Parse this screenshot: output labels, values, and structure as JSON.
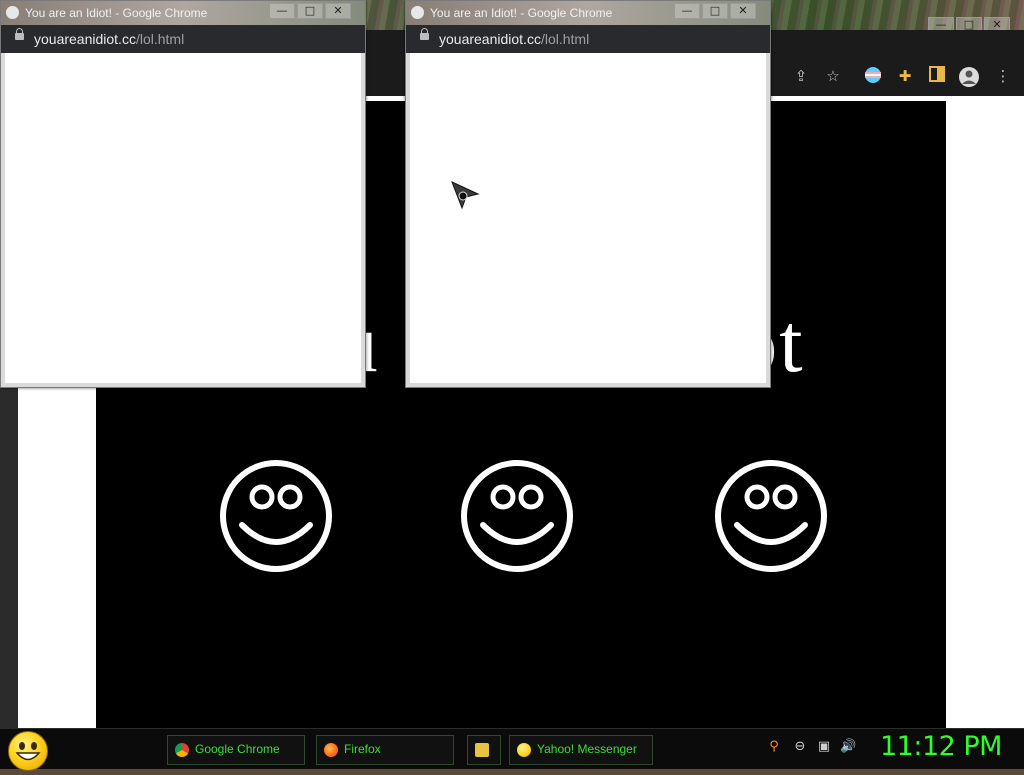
{
  "popups": [
    {
      "title": "You are an Idiot! - Google Chrome",
      "url_host": "youareanidiot.cc",
      "url_path": "/lol.html"
    },
    {
      "title": "You are an Idiot! - Google Chrome",
      "url_host": "youareanidiot.cc",
      "url_path": "/lol.html"
    }
  ],
  "window_controls": {
    "minimize": "—",
    "maximize": "□",
    "close": "✕"
  },
  "main_page": {
    "heading": "You are an idiot"
  },
  "toolbar_icons": [
    "share-icon",
    "star-icon",
    "trans-flag-extension-icon",
    "extensions-puzzle-icon",
    "reading-list-icon",
    "profile-avatar-icon",
    "menu-kebab-icon"
  ],
  "taskbar": {
    "tasks": [
      {
        "label": "Google Chrome",
        "icon": "chrome-icon"
      },
      {
        "label": "Firefox",
        "icon": "firefox-icon"
      },
      {
        "label": "",
        "icon": "folder-icon"
      },
      {
        "label": "Yahoo! Messenger",
        "icon": "yahoo-messenger-icon"
      }
    ],
    "clock": "11:12 PM"
  },
  "colors": {
    "clock": "#2dff2d",
    "task_text": "#3ddc3d",
    "page_bg": "#000000"
  }
}
